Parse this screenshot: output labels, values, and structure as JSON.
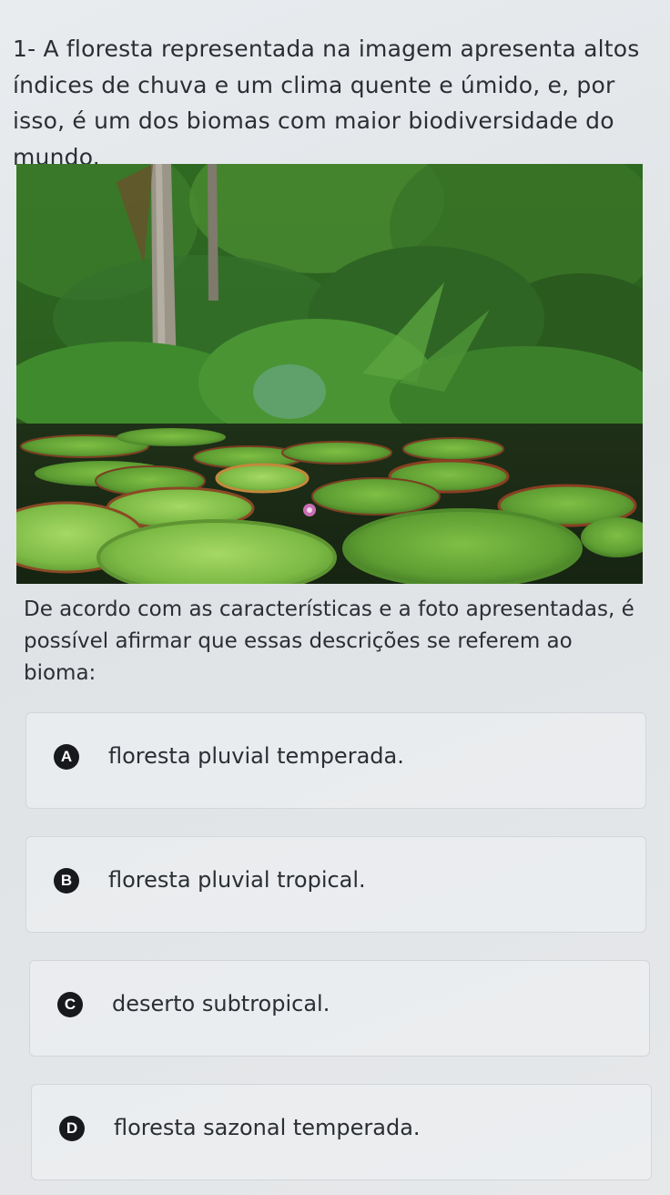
{
  "question": {
    "text": "1- A floresta representada na imagem apresenta altos índices de chuva e um clima quente e úmido, e, por isso, é um dos biomas com maior biodiversidade do mundo."
  },
  "photo": {
    "subject": "tropical rainforest with giant water lilies (vitória-régia)"
  },
  "prompt": {
    "text": "De acordo com as características e a foto apresentadas, é possível afirmar que essas descrições se referem ao bioma:"
  },
  "options": [
    {
      "letter": "A",
      "text": "floresta pluvial temperada."
    },
    {
      "letter": "B",
      "text": "floresta pluvial tropical."
    },
    {
      "letter": "C",
      "text": "deserto subtropical."
    },
    {
      "letter": "D",
      "text": "floresta sazonal temperada."
    }
  ],
  "colors": {
    "badge": "#17191c",
    "text": "#2b2e33",
    "background": "#e6e8ea"
  }
}
